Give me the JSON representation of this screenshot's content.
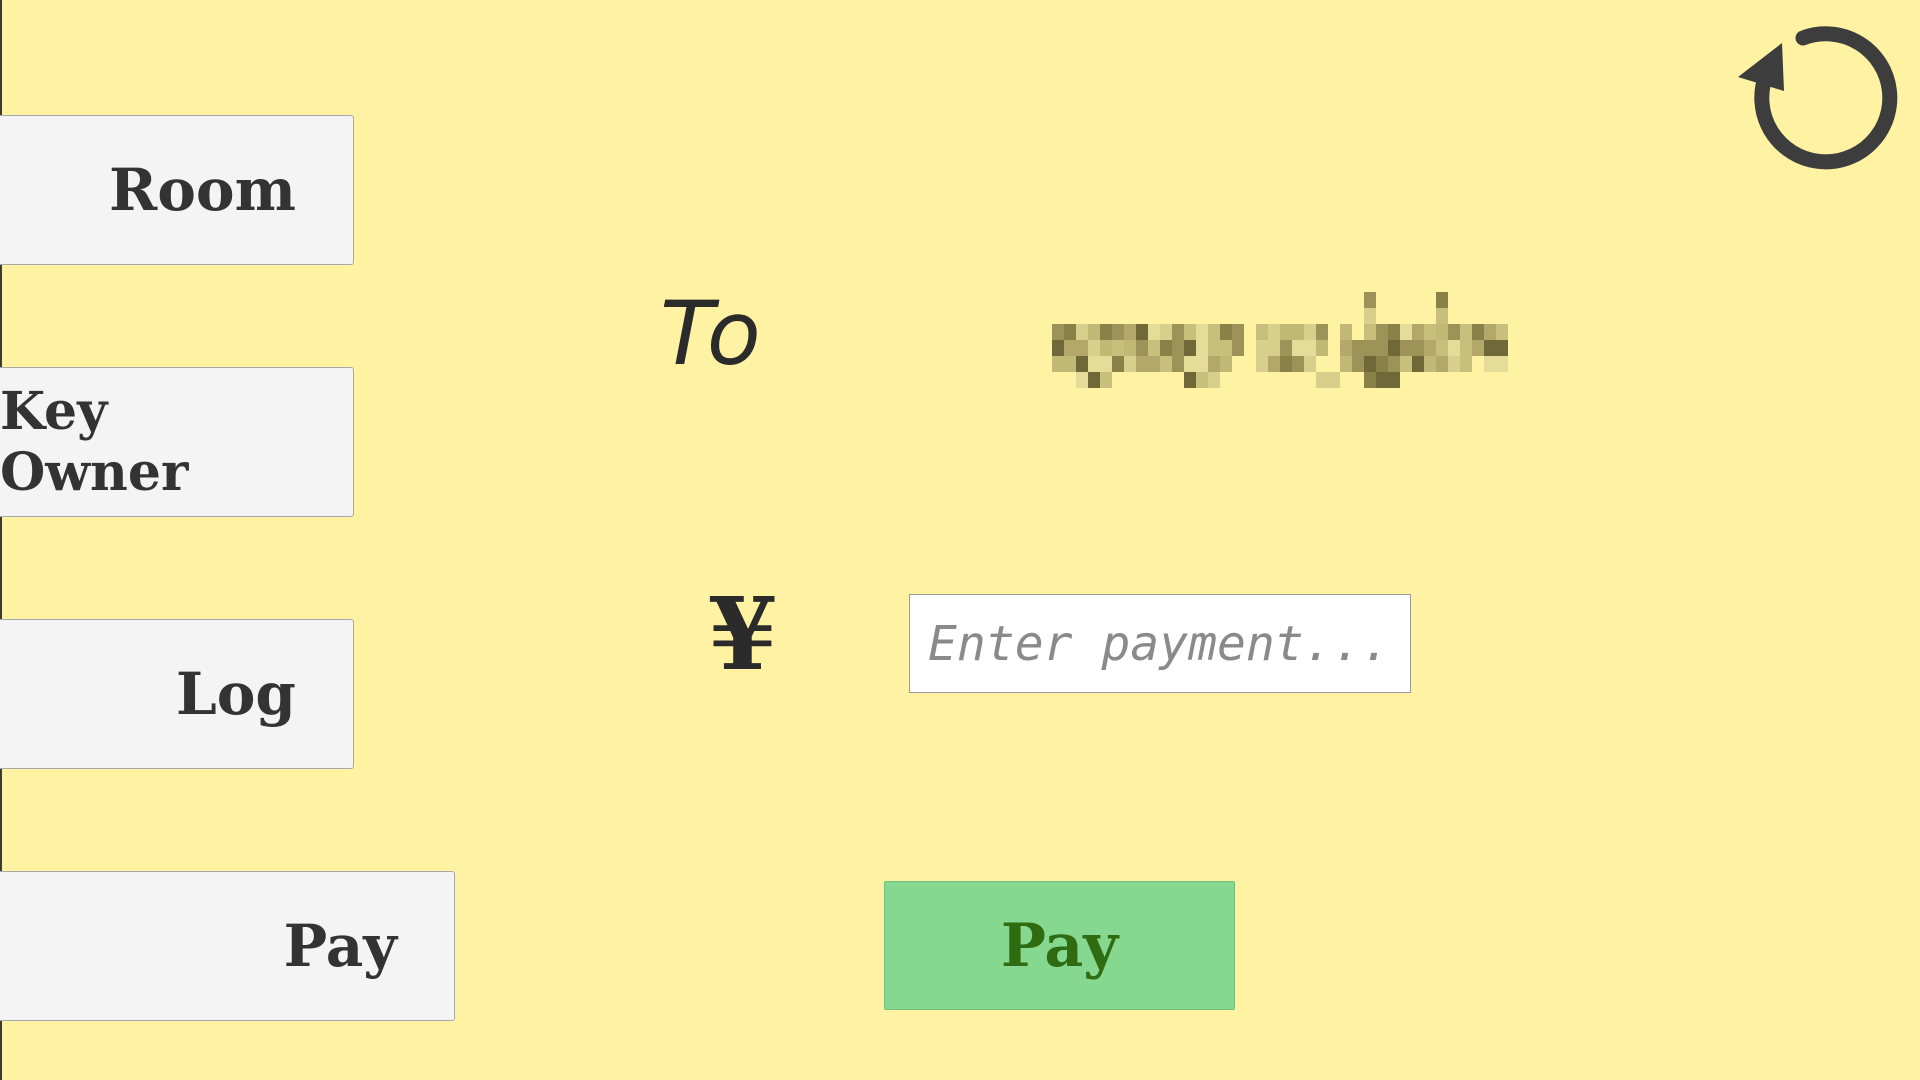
{
  "nav": {
    "room_label": "Room",
    "key_owner_label": "Key Owner",
    "log_label": "Log",
    "pay_label": "Pay"
  },
  "payment": {
    "to_label": "To",
    "recipient_name": "",
    "currency_symbol": "¥",
    "amount_placeholder": "Enter payment...",
    "amount_value": "",
    "submit_label": "Pay"
  },
  "icons": {
    "refresh": "refresh-icon"
  },
  "colors": {
    "background": "#fff2a3",
    "button_bg": "#f4f4f4",
    "pay_button_bg": "#86d891",
    "pay_button_text": "#2f6b10",
    "text": "#333333"
  }
}
